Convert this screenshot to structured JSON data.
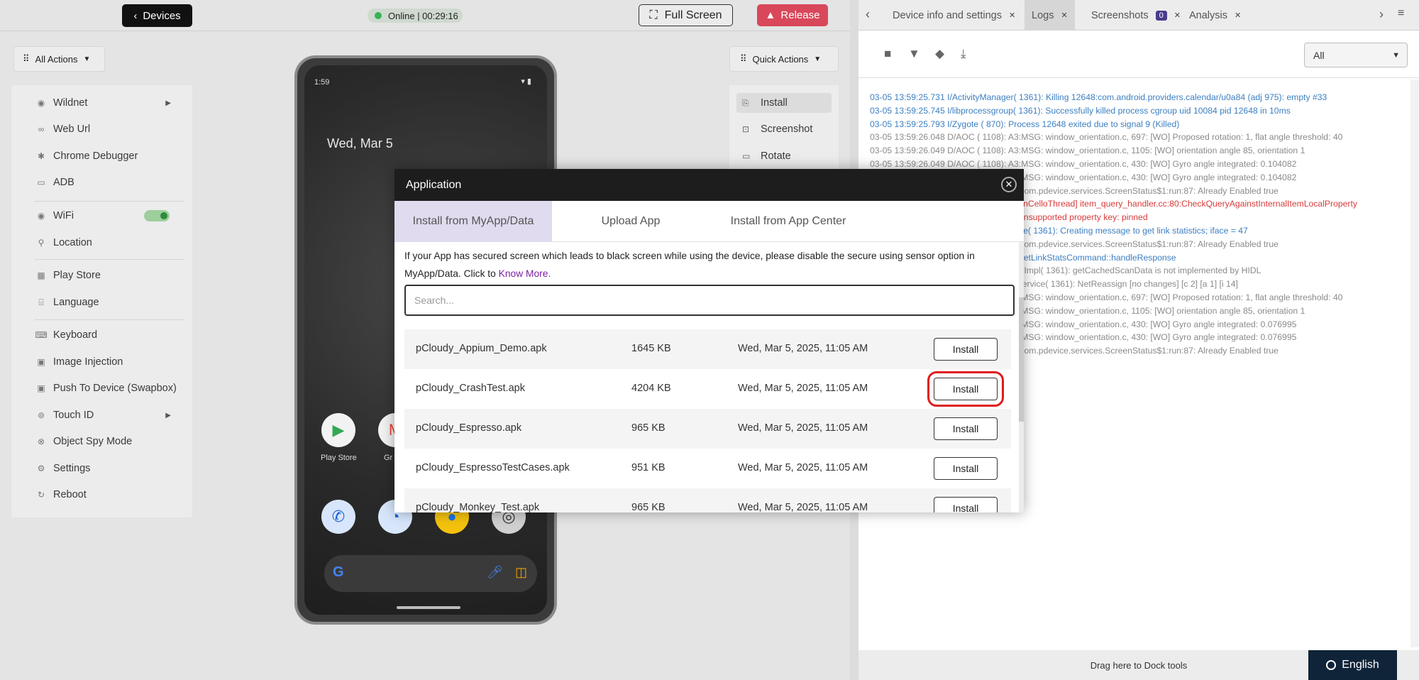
{
  "topbar": {
    "devices_label": "Devices",
    "status": "Online | 00:29:16",
    "fullscreen_label": "Full Screen",
    "release_label": "Release"
  },
  "sidebar": {
    "all_actions_label": "All Actions",
    "items": [
      {
        "label": "Wildnet",
        "icon": "wifi-icon"
      },
      {
        "label": "Web Url",
        "icon": "link-icon"
      },
      {
        "label": "Chrome Debugger",
        "icon": "bug-icon"
      },
      {
        "label": "ADB",
        "icon": "terminal-icon"
      },
      {
        "label": "WiFi",
        "icon": "wifi-icon"
      },
      {
        "label": "Location",
        "icon": "location-icon"
      },
      {
        "label": "Play Store",
        "icon": "grid-icon"
      },
      {
        "label": "Language",
        "icon": "language-icon"
      },
      {
        "label": "Keyboard",
        "icon": "keyboard-icon"
      },
      {
        "label": "Image Injection",
        "icon": "image-icon"
      },
      {
        "label": "Push To Device (Swapbox)",
        "icon": "push-icon"
      },
      {
        "label": "Touch ID",
        "icon": "fingerprint-icon"
      },
      {
        "label": "Object Spy Mode",
        "icon": "spy-icon"
      },
      {
        "label": "Settings",
        "icon": "gear-icon"
      },
      {
        "label": "Reboot",
        "icon": "reboot-icon"
      }
    ]
  },
  "phone": {
    "time": "1:59",
    "date": "Wed, Mar 5",
    "apps": [
      "Play Store",
      "Gr"
    ]
  },
  "quick_actions": {
    "label": "Quick Actions",
    "items": [
      "Install",
      "Screenshot",
      "Rotate"
    ]
  },
  "right_panel": {
    "tabs": [
      {
        "label": "Device info and settings"
      },
      {
        "label": "Logs"
      },
      {
        "label": "Screenshots",
        "badge": "0"
      },
      {
        "label": "Analysis"
      }
    ],
    "filter_value": "All",
    "logs": [
      {
        "level": "info",
        "text": "03-05 13:59:25.731 I/ActivityManager( 1361): Killing 12648:com.android.providers.calendar/u0a84 (adj 975): empty #33"
      },
      {
        "level": "info",
        "text": "03-05 13:59:25.745 I/libprocessgroup( 1361): Successfully killed process cgroup uid 10084 pid 12648 in 10ms"
      },
      {
        "level": "info",
        "text": "03-05 13:59:25.793 I/Zygote ( 870): Process 12648 exited due to signal 9 (Killed)"
      },
      {
        "level": "debug",
        "text": "03-05 13:59:26.048 D/AOC ( 1108): A3:MSG: window_orientation.c, 697: [WO] Proposed rotation: 1, flat angle threshold: 40"
      },
      {
        "level": "debug",
        "text": "03-05 13:59:26.049 D/AOC ( 1108): A3:MSG: window_orientation.c, 1105: [WO] orientation angle 85, orientation 1"
      },
      {
        "level": "debug",
        "text": "03-05 13:59:26.049 D/AOC ( 1108): A3:MSG: window_orientation.c, 430: [WO] Gyro angle integrated: 0.104082"
      },
      {
        "level": "debug",
        "text": "03-05 13:59:26.049 D/AOC ( 1108): A3:MSG: window_orientation.c, 430: [WO] Gyro angle integrated: 0.104082"
      },
      {
        "level": "debug",
        "text": "03-05 13:59:26.050 D/pCloudy( 2638): com.pdevice.services.ScreenStatus$1:run:87: Already Enabled true"
      },
      {
        "level": "error",
        "text": "03-05 13:59:26.102 E/Finsky( 12745:NonCelloThread] item_query_handler.cc:80:CheckQueryAgainstInternalItemLocalProperty"
      },
      {
        "level": "error",
        "text": "03-05 13:59:26.102 E/Finsky( 12745): Unsupported property key: pinned"
      },
      {
        "level": "info",
        "text": "03-05 13:59:26.210 I/ConnectivityService( 1361): Creating message to get link statistics; iface = 47"
      },
      {
        "level": "debug",
        "text": "03-05 13:59:27.050 D/pCloudy( 2638): com.pdevice.services.ScreenStatus$1:run:87: Already Enabled true"
      },
      {
        "level": "info",
        "text": "03-05 13:59:27.112 I/WifiHAL ( 1361): GetLinkStatsCommand::handleResponse"
      },
      {
        "level": "debug",
        "text": "03-05 13:59:27.160 D/WifiScanner.ScanImpl( 1361): getCachedScanData is not implemented by HIDL"
      },
      {
        "level": "debug",
        "text": "03-05 13:59:27.190 D/NetworkMonitorService( 1361): NetReassign [no changes] [c 2] [a 1] [i 14]"
      },
      {
        "level": "debug",
        "text": "03-05 13:59:27.248 D/AOC ( 1108): A3:MSG: window_orientation.c, 697: [WO] Proposed rotation: 1, flat angle threshold: 40"
      },
      {
        "level": "debug",
        "text": "03-05 13:59:27.249 D/AOC ( 1108): A3:MSG: window_orientation.c, 1105: [WO] orientation angle 85, orientation 1"
      },
      {
        "level": "debug",
        "text": "03-05 13:59:27.249 D/AOC ( 1108): A3:MSG: window_orientation.c, 430: [WO] Gyro angle integrated: 0.076995"
      },
      {
        "level": "debug",
        "text": "03-05 13:59:27.249 D/AOC ( 1108): A3:MSG: window_orientation.c, 430: [WO] Gyro angle integrated: 0.076995"
      },
      {
        "level": "debug",
        "text": "03-05 13:59:28.050 D/pCloudy( 2638): com.pdevice.services.ScreenStatus$1:run:87: Already Enabled true"
      }
    ],
    "dock_hint": "Drag here to Dock tools"
  },
  "language_label": "English",
  "modal": {
    "title": "Application",
    "tabs": [
      "Install from MyApp/Data",
      "Upload App",
      "Install from App Center"
    ],
    "notice": "If your App has secured screen which leads to black screen while using the device, please disable the secure using sensor option in MyApp/Data. Click to",
    "notice_link": "Know More.",
    "search_placeholder": "Search...",
    "install_label": "Install",
    "files": [
      {
        "name": "pCloudy_Appium_Demo.apk",
        "size": "1645 KB",
        "date": "Wed, Mar 5, 2025, 11:05 AM"
      },
      {
        "name": "pCloudy_CrashTest.apk",
        "size": "4204 KB",
        "date": "Wed, Mar 5, 2025, 11:05 AM"
      },
      {
        "name": "pCloudy_Espresso.apk",
        "size": "965 KB",
        "date": "Wed, Mar 5, 2025, 11:05 AM"
      },
      {
        "name": "pCloudy_EspressoTestCases.apk",
        "size": "951 KB",
        "date": "Wed, Mar 5, 2025, 11:05 AM"
      },
      {
        "name": "pCloudy_Monkey_Test.apk",
        "size": "965 KB",
        "date": "Wed, Mar 5, 2025, 11:05 AM"
      }
    ]
  },
  "colors": {
    "release": "#d9475b",
    "online": "#35b357",
    "highlight": "#e01a1a",
    "active_tab": "#e0dbee",
    "log_info": "#3c7fc0",
    "log_error": "#d83a3a"
  }
}
